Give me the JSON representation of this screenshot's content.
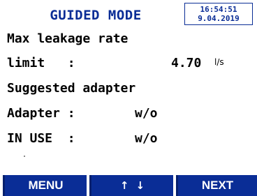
{
  "header": {
    "mode_title": "GUIDED MODE",
    "time": "16:54:51",
    "date": "9.04.2019"
  },
  "content": {
    "line1": "Max leakage rate",
    "limit_label": "limit   :",
    "limit_value": "4.70",
    "limit_unit": "l/s",
    "line3": "Suggested adapter",
    "adapter_label": "Adapter :",
    "adapter_value": "w/o",
    "in_use_label": "IN USE  :",
    "in_use_value": "w/o"
  },
  "softkeys": {
    "left": "MENU",
    "middle_up": "↑",
    "middle_down": "↓",
    "right": "NEXT"
  },
  "colors": {
    "accent": "#0a2d96",
    "text": "#000000",
    "background": "#ffffff"
  }
}
